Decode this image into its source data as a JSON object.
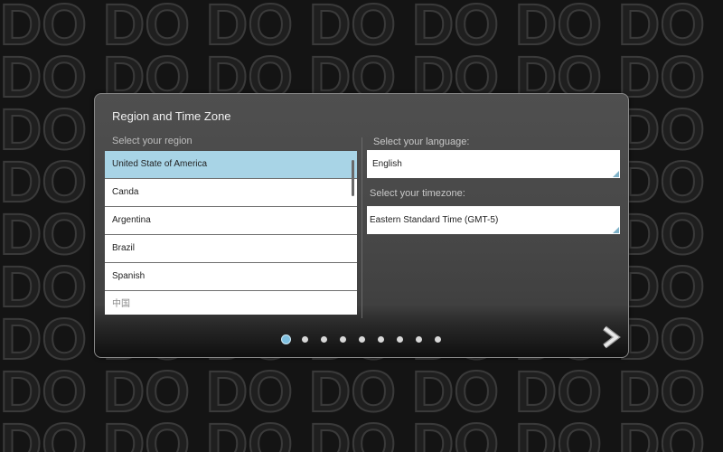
{
  "dialog": {
    "title": "Region and Time Zone",
    "region_label": "Select your region",
    "regions": [
      {
        "label": "United State of America",
        "selected": true
      },
      {
        "label": "Canda",
        "selected": false
      },
      {
        "label": "Argentina",
        "selected": false
      },
      {
        "label": "Brazil",
        "selected": false
      },
      {
        "label": "Spanish",
        "selected": false
      },
      {
        "label": "中国",
        "selected": false
      }
    ],
    "language_label": "Select your language:",
    "language_value": "English",
    "timezone_label": "Select your timezone:",
    "timezone_value": "Eastern Standard Time (GMT-5)"
  },
  "pager": {
    "total_pages": 9,
    "current_page": 1
  },
  "icons": {
    "next": "chevron-right-icon"
  },
  "colors": {
    "selected_row": "#a8d4e6",
    "active_dot": "#7fc0e0",
    "background": "#141414"
  }
}
